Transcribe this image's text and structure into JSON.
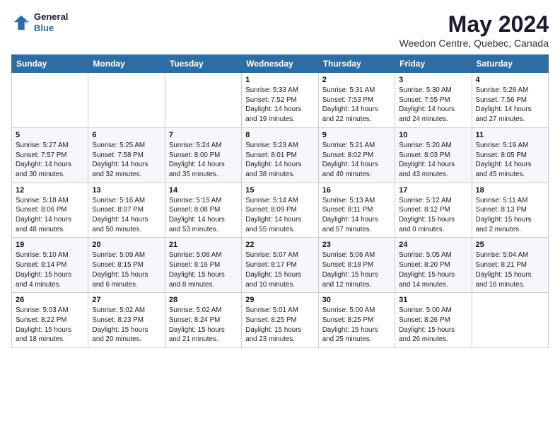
{
  "header": {
    "logo_general": "General",
    "logo_blue": "Blue",
    "month_year": "May 2024",
    "location": "Weedon Centre, Quebec, Canada"
  },
  "days_of_week": [
    "Sunday",
    "Monday",
    "Tuesday",
    "Wednesday",
    "Thursday",
    "Friday",
    "Saturday"
  ],
  "weeks": [
    [
      {
        "day": "",
        "info": ""
      },
      {
        "day": "",
        "info": ""
      },
      {
        "day": "",
        "info": ""
      },
      {
        "day": "1",
        "info": "Sunrise: 5:33 AM\nSunset: 7:52 PM\nDaylight: 14 hours\nand 19 minutes."
      },
      {
        "day": "2",
        "info": "Sunrise: 5:31 AM\nSunset: 7:53 PM\nDaylight: 14 hours\nand 22 minutes."
      },
      {
        "day": "3",
        "info": "Sunrise: 5:30 AM\nSunset: 7:55 PM\nDaylight: 14 hours\nand 24 minutes."
      },
      {
        "day": "4",
        "info": "Sunrise: 5:28 AM\nSunset: 7:56 PM\nDaylight: 14 hours\nand 27 minutes."
      }
    ],
    [
      {
        "day": "5",
        "info": "Sunrise: 5:27 AM\nSunset: 7:57 PM\nDaylight: 14 hours\nand 30 minutes."
      },
      {
        "day": "6",
        "info": "Sunrise: 5:25 AM\nSunset: 7:58 PM\nDaylight: 14 hours\nand 32 minutes."
      },
      {
        "day": "7",
        "info": "Sunrise: 5:24 AM\nSunset: 8:00 PM\nDaylight: 14 hours\nand 35 minutes."
      },
      {
        "day": "8",
        "info": "Sunrise: 5:23 AM\nSunset: 8:01 PM\nDaylight: 14 hours\nand 38 minutes."
      },
      {
        "day": "9",
        "info": "Sunrise: 5:21 AM\nSunset: 8:02 PM\nDaylight: 14 hours\nand 40 minutes."
      },
      {
        "day": "10",
        "info": "Sunrise: 5:20 AM\nSunset: 8:03 PM\nDaylight: 14 hours\nand 43 minutes."
      },
      {
        "day": "11",
        "info": "Sunrise: 5:19 AM\nSunset: 8:05 PM\nDaylight: 14 hours\nand 45 minutes."
      }
    ],
    [
      {
        "day": "12",
        "info": "Sunrise: 5:18 AM\nSunset: 8:06 PM\nDaylight: 14 hours\nand 48 minutes."
      },
      {
        "day": "13",
        "info": "Sunrise: 5:16 AM\nSunset: 8:07 PM\nDaylight: 14 hours\nand 50 minutes."
      },
      {
        "day": "14",
        "info": "Sunrise: 5:15 AM\nSunset: 8:08 PM\nDaylight: 14 hours\nand 53 minutes."
      },
      {
        "day": "15",
        "info": "Sunrise: 5:14 AM\nSunset: 8:09 PM\nDaylight: 14 hours\nand 55 minutes."
      },
      {
        "day": "16",
        "info": "Sunrise: 5:13 AM\nSunset: 8:11 PM\nDaylight: 14 hours\nand 57 minutes."
      },
      {
        "day": "17",
        "info": "Sunrise: 5:12 AM\nSunset: 8:12 PM\nDaylight: 15 hours\nand 0 minutes."
      },
      {
        "day": "18",
        "info": "Sunrise: 5:11 AM\nSunset: 8:13 PM\nDaylight: 15 hours\nand 2 minutes."
      }
    ],
    [
      {
        "day": "19",
        "info": "Sunrise: 5:10 AM\nSunset: 8:14 PM\nDaylight: 15 hours\nand 4 minutes."
      },
      {
        "day": "20",
        "info": "Sunrise: 5:09 AM\nSunset: 8:15 PM\nDaylight: 15 hours\nand 6 minutes."
      },
      {
        "day": "21",
        "info": "Sunrise: 5:08 AM\nSunset: 8:16 PM\nDaylight: 15 hours\nand 8 minutes."
      },
      {
        "day": "22",
        "info": "Sunrise: 5:07 AM\nSunset: 8:17 PM\nDaylight: 15 hours\nand 10 minutes."
      },
      {
        "day": "23",
        "info": "Sunrise: 5:06 AM\nSunset: 8:18 PM\nDaylight: 15 hours\nand 12 minutes."
      },
      {
        "day": "24",
        "info": "Sunrise: 5:05 AM\nSunset: 8:20 PM\nDaylight: 15 hours\nand 14 minutes."
      },
      {
        "day": "25",
        "info": "Sunrise: 5:04 AM\nSunset: 8:21 PM\nDaylight: 15 hours\nand 16 minutes."
      }
    ],
    [
      {
        "day": "26",
        "info": "Sunrise: 5:03 AM\nSunset: 8:22 PM\nDaylight: 15 hours\nand 18 minutes."
      },
      {
        "day": "27",
        "info": "Sunrise: 5:02 AM\nSunset: 8:23 PM\nDaylight: 15 hours\nand 20 minutes."
      },
      {
        "day": "28",
        "info": "Sunrise: 5:02 AM\nSunset: 8:24 PM\nDaylight: 15 hours\nand 21 minutes."
      },
      {
        "day": "29",
        "info": "Sunrise: 5:01 AM\nSunset: 8:25 PM\nDaylight: 15 hours\nand 23 minutes."
      },
      {
        "day": "30",
        "info": "Sunrise: 5:00 AM\nSunset: 8:25 PM\nDaylight: 15 hours\nand 25 minutes."
      },
      {
        "day": "31",
        "info": "Sunrise: 5:00 AM\nSunset: 8:26 PM\nDaylight: 15 hours\nand 26 minutes."
      },
      {
        "day": "",
        "info": ""
      }
    ]
  ]
}
